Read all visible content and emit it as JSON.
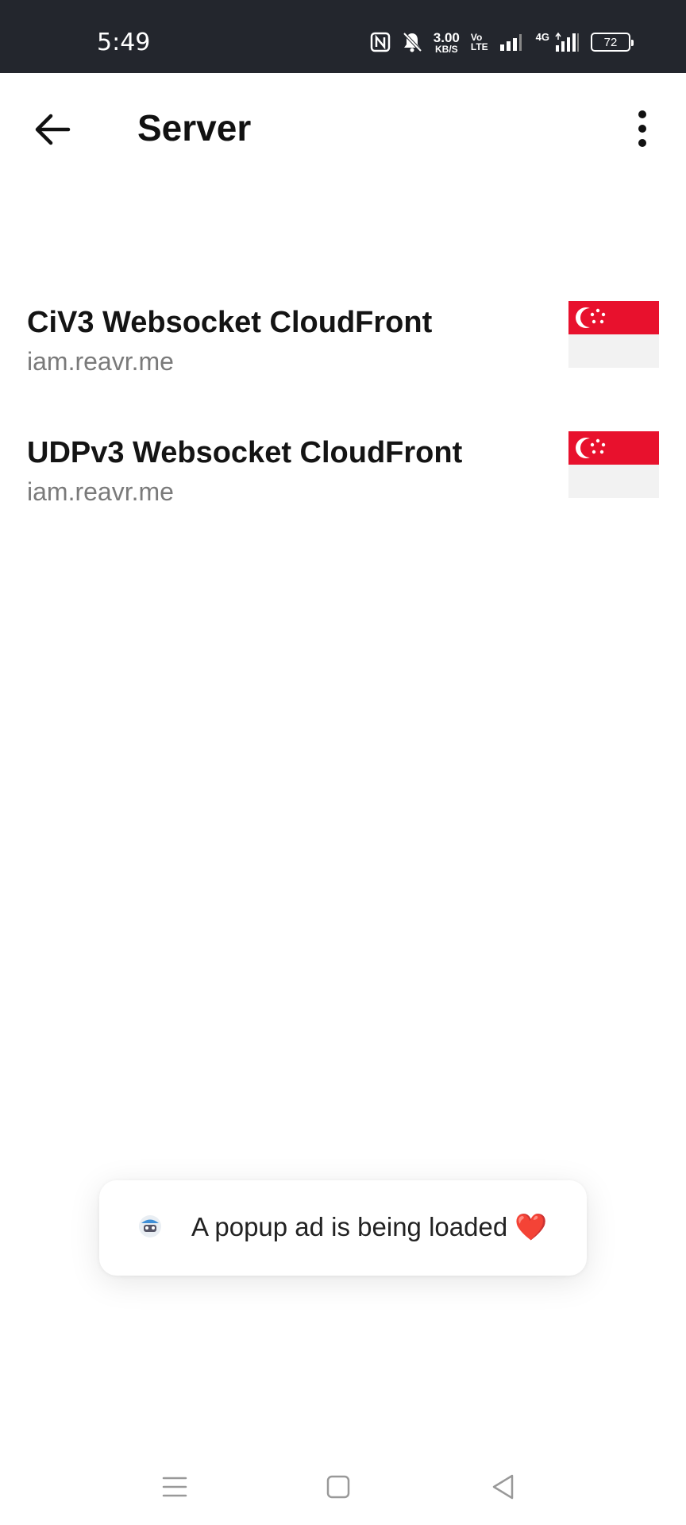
{
  "status_bar": {
    "time": "5:49",
    "speed_value": "3.00",
    "speed_unit": "KB/S",
    "volte_top": "Vo",
    "volte_bottom": "LTE",
    "network_type": "4G",
    "battery": "72"
  },
  "app_bar": {
    "title": "Server"
  },
  "servers": [
    {
      "name": "CiV3 Websocket CloudFront",
      "host": "iam.reavr.me",
      "flag_icon": "singapore-flag"
    },
    {
      "name": "UDPv3 Websocket CloudFront",
      "host": "iam.reavr.me",
      "flag_icon": "singapore-flag"
    }
  ],
  "toast": {
    "text": "A popup ad is being loaded ❤️"
  },
  "colors": {
    "status_bar_bg": "#23262d",
    "flag_red": "#e8112d",
    "text_primary": "#141414",
    "text_secondary": "#7a7a7a"
  }
}
